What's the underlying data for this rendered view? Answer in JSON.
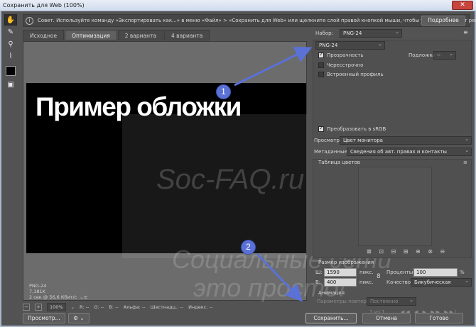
{
  "window": {
    "title": "Сохранить для Web (100%)",
    "close_label": "✕"
  },
  "tip": {
    "text": "Совет. Используйте команду «Экспортировать как...» в меню «Файл» > «Сохранить для Web» или щелкните слой правой кнопкой мыши, чтобы ускорить экспорт ресурсов",
    "more_label": "Подробнее"
  },
  "tabs": [
    "Исходное",
    "Оптимизация",
    "2 варианта",
    "4 варианта"
  ],
  "preview": {
    "cover_text": "Пример обложки",
    "watermark_line1": "Soc-FAQ.ru",
    "watermark_line2": "Социальные сети",
    "watermark_line3": "это просто!",
    "info_format": "PNG-24",
    "info_size": "7,181K",
    "info_time": "2 сек @ 56,6 Кбит/с"
  },
  "status": {
    "zoom": "100%",
    "r": "R: --",
    "g": "G: --",
    "b": "B: --",
    "alpha": "Альфа: --",
    "hex": "Шестнадц.: --",
    "index": "Индекс: --"
  },
  "panel": {
    "preset_label": "Набор:",
    "preset_value": "PNG-24",
    "format_value": "PNG-24",
    "transparency_label": "Прозрачность",
    "matte_label": "Подложка:",
    "matte_value": "--",
    "interlaced_label": "Чересстрочно",
    "embed_profile_label": "Встроенный профиль",
    "convert_srgb_label": "Преобразовать в sRGB",
    "preview_label": "Просмотр:",
    "preview_value": "Цвет монитора",
    "metadata_label": "Метаданные:",
    "metadata_value": "Сведения об авт. правах и контакты",
    "color_table_label": "Таблица цветов",
    "image_size_label": "Размер изображения",
    "width_label": "Ш:",
    "width_value": "1590",
    "height_label": "В:",
    "height_value": "400",
    "px_label": "пикс.",
    "percent_label": "Проценты:",
    "percent_value": "100",
    "percent_sign": "%",
    "quality_label": "Качество:",
    "quality_value": "Бикубическая",
    "animation_label": "Анимация",
    "loop_label": "Параметры повтора:",
    "loop_value": "Постоянно",
    "frame_counter": "1 из 1"
  },
  "buttons": {
    "browser_preview": "Просмотр...",
    "save": "Сохранить...",
    "cancel": "Отмена",
    "done": "Готово"
  },
  "annotations": [
    "1",
    "2"
  ],
  "colors": {
    "annotation": "#5a71d6",
    "background": "#535353"
  }
}
